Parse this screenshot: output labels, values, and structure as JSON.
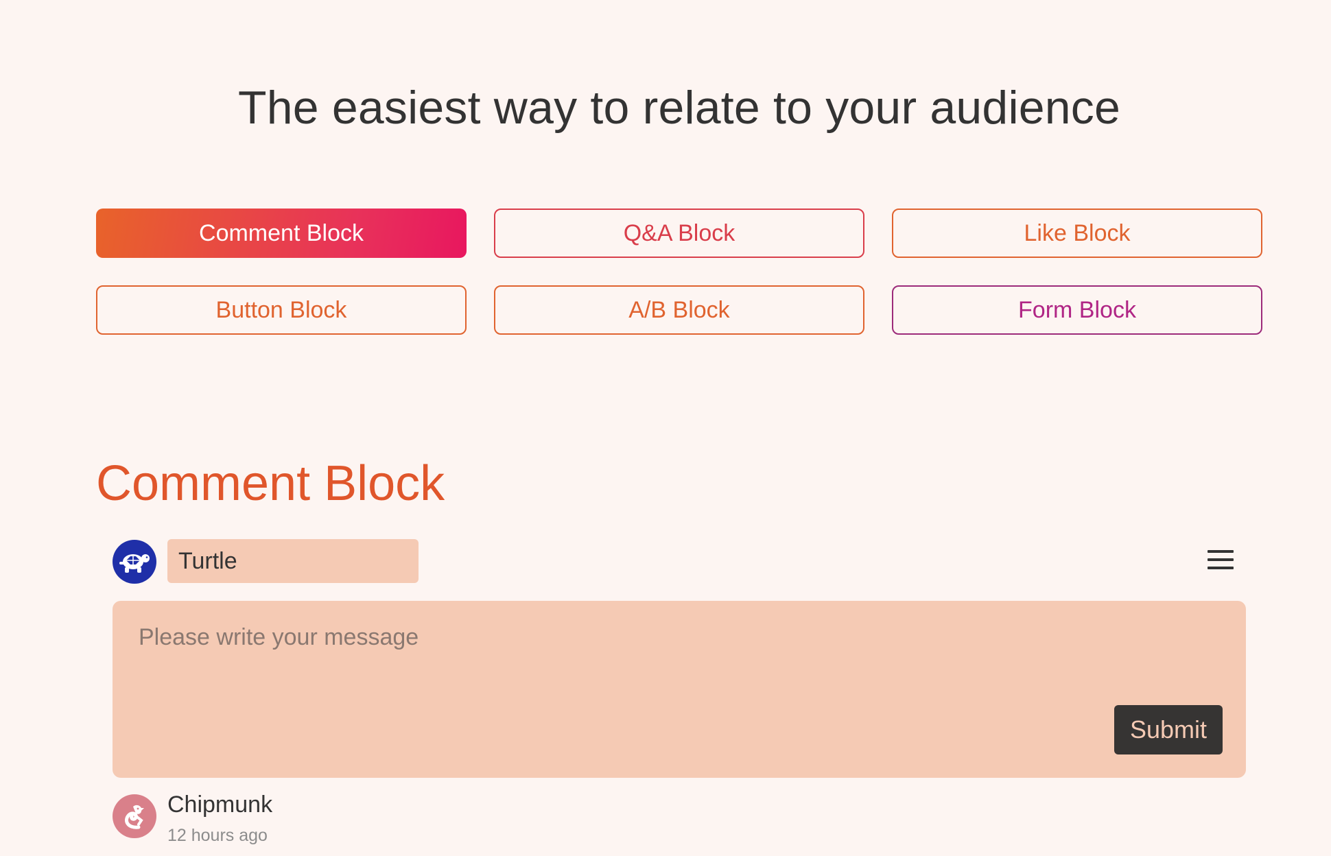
{
  "headline": "The easiest way to relate to your audience",
  "tabs": [
    {
      "label": "Comment Block",
      "active": true
    },
    {
      "label": "Q&A Block"
    },
    {
      "label": "Like Block"
    },
    {
      "label": "Button Block"
    },
    {
      "label": "A/B Block"
    },
    {
      "label": "Form Block"
    }
  ],
  "section": {
    "title": "Comment Block"
  },
  "composer": {
    "author_avatar_icon": "turtle-icon",
    "name_value": "Turtle",
    "menu_icon": "hamburger-menu-icon",
    "message_placeholder": "Please write your message",
    "submit_label": "Submit"
  },
  "comments": [
    {
      "avatar_icon": "chipmunk-icon",
      "author": "Chipmunk",
      "time": "12 hours ago"
    }
  ],
  "colors": {
    "background": "#fdf5f2",
    "accent": "#e0562b",
    "gradient_start": "#e8632a",
    "gradient_end": "#e8175f",
    "composer_bg": "#f5cab4",
    "submit_bg": "#363433",
    "turtle_avatar": "#1f2fa8",
    "chipmunk_avatar": "#d9808a"
  }
}
